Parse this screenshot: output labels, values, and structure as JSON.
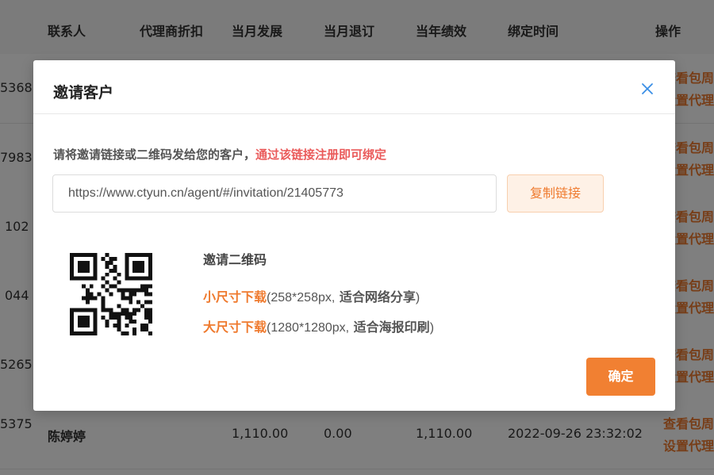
{
  "table": {
    "headers": [
      "联系人",
      "代理商折扣",
      "当月发展",
      "当月退订",
      "当年绩效",
      "绑定时间",
      "操作"
    ],
    "rows": [
      {
        "id_tail": "5368",
        "contact": "",
        "dev": "",
        "unsub": "",
        "perf": "",
        "time": "",
        "op1": "查看包周",
        "op2": "设置代理"
      },
      {
        "id_tail": "7983",
        "contact": "",
        "dev": "",
        "unsub": "",
        "perf": "",
        "time": "",
        "op1": "查看包周",
        "op2": "设置代理"
      },
      {
        "id_tail": "102",
        "contact": "",
        "dev": "",
        "unsub": "",
        "perf": "",
        "time": "",
        "op1": "查看包周",
        "op2": "设置代理"
      },
      {
        "id_tail": "044",
        "contact": "",
        "dev": "",
        "unsub": "",
        "perf": "",
        "time": "",
        "op1": "查看包周",
        "op2": "设置代理"
      },
      {
        "id_tail": "5265",
        "contact": "",
        "dev": "",
        "unsub": "",
        "perf": "",
        "time": "",
        "op1": "查看包周",
        "op2": "设置代理"
      },
      {
        "id_tail": "5375",
        "contact": "陈婷婷",
        "dev": "1,110.00",
        "unsub": "0.00",
        "perf": "1,110.00",
        "time": "2022-09-26 23:32:02",
        "op1": "查看包周",
        "op2": "设置代理"
      }
    ]
  },
  "modal": {
    "title": "邀请客户",
    "desc_prefix": "请将邀请链接或二维码发给您的客户，",
    "desc_highlight": "通过该链接注册即可绑定",
    "link_value": "https://www.ctyun.cn/agent/#/invitation/21405773",
    "copy_label": "复制链接",
    "qr_title": "邀请二维码",
    "small_dl": "小尺寸下载",
    "small_paren_open": "(",
    "small_size": "258*258px,",
    "small_desc": " 适合网络分享",
    "small_paren_close": ")",
    "large_dl": "大尺寸下载",
    "large_paren_open": "(",
    "large_size": "1280*1280px,",
    "large_desc": " 适合海报印刷",
    "large_paren_close": ")",
    "ok_label": "确定"
  },
  "colors": {
    "accent": "#ef7a2e",
    "highlight": "#ea5b5b",
    "close_icon": "#3a8ee6"
  },
  "icons": {
    "close": "close-icon",
    "qr": "qr-code-image"
  }
}
